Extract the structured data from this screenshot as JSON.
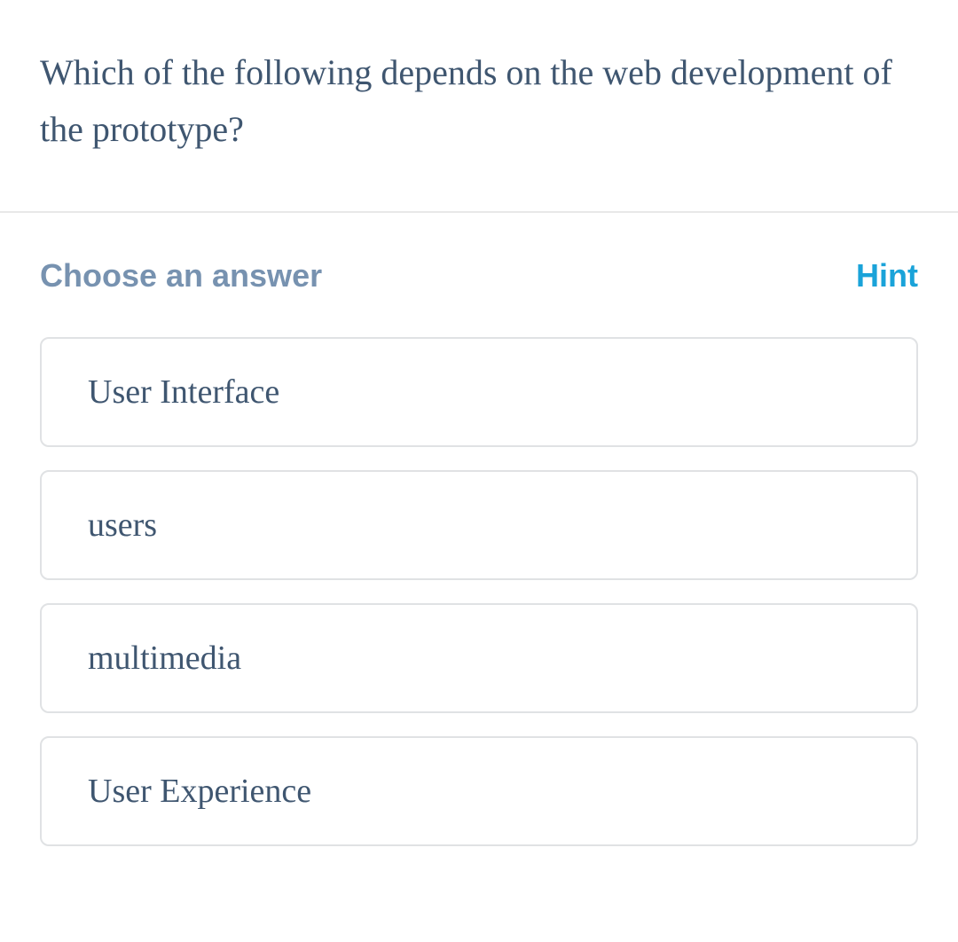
{
  "question": {
    "text": "Which of the following depends on the web development of the prototype?"
  },
  "answer": {
    "choose_label": "Choose an answer",
    "hint_label": "Hint",
    "options": [
      {
        "text": "User Interface"
      },
      {
        "text": "users"
      },
      {
        "text": "multimedia"
      },
      {
        "text": "User Experience"
      }
    ]
  }
}
